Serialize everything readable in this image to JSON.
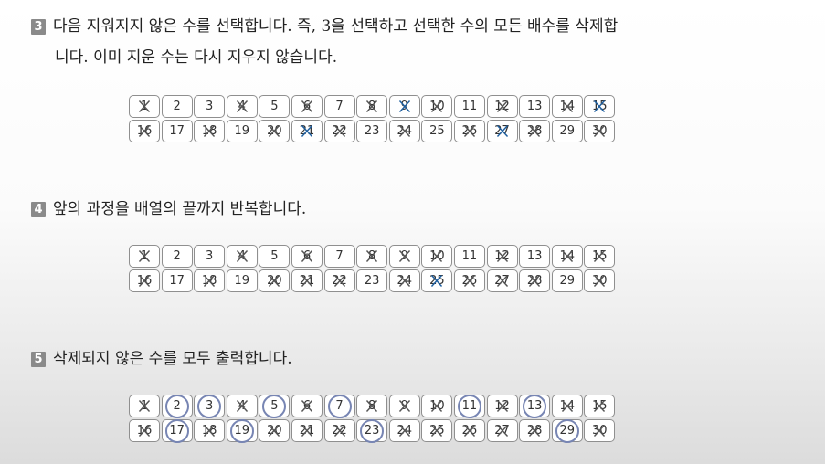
{
  "step3": {
    "badge": "3",
    "line1": "다음 지워지지 않은 수를 선택합니다. 즉, 3을 선택하고 선택한 수의 모든 배수를 삭제합",
    "line2": "니다. 이미 지운 수는 다시 지우지 않습니다."
  },
  "step4": {
    "badge": "4",
    "line1": "앞의 과정을 배열의 끝까지 반복합니다."
  },
  "step5": {
    "badge": "5",
    "line1": "삭제되지 않은 수를 모두 출력합니다."
  },
  "colors": {
    "cross_gray": "#555555",
    "cross_blue": "#1f5f9f",
    "ring": "#7785b3"
  },
  "grids": [
    {
      "name": "grid-step3",
      "cells": [
        {
          "n": "1",
          "mark": "gray"
        },
        {
          "n": "2",
          "mark": "none"
        },
        {
          "n": "3",
          "mark": "none"
        },
        {
          "n": "4",
          "mark": "gray"
        },
        {
          "n": "5",
          "mark": "none"
        },
        {
          "n": "6",
          "mark": "gray"
        },
        {
          "n": "7",
          "mark": "none"
        },
        {
          "n": "8",
          "mark": "gray"
        },
        {
          "n": "9",
          "mark": "blue"
        },
        {
          "n": "10",
          "mark": "gray"
        },
        {
          "n": "11",
          "mark": "none"
        },
        {
          "n": "12",
          "mark": "gray"
        },
        {
          "n": "13",
          "mark": "none"
        },
        {
          "n": "14",
          "mark": "gray"
        },
        {
          "n": "15",
          "mark": "blue"
        },
        {
          "n": "16",
          "mark": "gray"
        },
        {
          "n": "17",
          "mark": "none"
        },
        {
          "n": "18",
          "mark": "gray"
        },
        {
          "n": "19",
          "mark": "none"
        },
        {
          "n": "20",
          "mark": "gray"
        },
        {
          "n": "21",
          "mark": "blue"
        },
        {
          "n": "22",
          "mark": "gray"
        },
        {
          "n": "23",
          "mark": "none"
        },
        {
          "n": "24",
          "mark": "gray"
        },
        {
          "n": "25",
          "mark": "none"
        },
        {
          "n": "26",
          "mark": "gray"
        },
        {
          "n": "27",
          "mark": "blue"
        },
        {
          "n": "28",
          "mark": "gray"
        },
        {
          "n": "29",
          "mark": "none"
        },
        {
          "n": "30",
          "mark": "gray"
        }
      ]
    },
    {
      "name": "grid-step4",
      "cells": [
        {
          "n": "1",
          "mark": "gray"
        },
        {
          "n": "2",
          "mark": "none"
        },
        {
          "n": "3",
          "mark": "none"
        },
        {
          "n": "4",
          "mark": "gray"
        },
        {
          "n": "5",
          "mark": "none"
        },
        {
          "n": "6",
          "mark": "gray"
        },
        {
          "n": "7",
          "mark": "none"
        },
        {
          "n": "8",
          "mark": "gray"
        },
        {
          "n": "9",
          "mark": "gray"
        },
        {
          "n": "10",
          "mark": "gray"
        },
        {
          "n": "11",
          "mark": "none"
        },
        {
          "n": "12",
          "mark": "gray"
        },
        {
          "n": "13",
          "mark": "none"
        },
        {
          "n": "14",
          "mark": "gray"
        },
        {
          "n": "15",
          "mark": "gray"
        },
        {
          "n": "16",
          "mark": "gray"
        },
        {
          "n": "17",
          "mark": "none"
        },
        {
          "n": "18",
          "mark": "gray"
        },
        {
          "n": "19",
          "mark": "none"
        },
        {
          "n": "20",
          "mark": "gray"
        },
        {
          "n": "21",
          "mark": "gray"
        },
        {
          "n": "22",
          "mark": "gray"
        },
        {
          "n": "23",
          "mark": "none"
        },
        {
          "n": "24",
          "mark": "gray"
        },
        {
          "n": "25",
          "mark": "blue"
        },
        {
          "n": "26",
          "mark": "gray"
        },
        {
          "n": "27",
          "mark": "gray"
        },
        {
          "n": "28",
          "mark": "gray"
        },
        {
          "n": "29",
          "mark": "none"
        },
        {
          "n": "30",
          "mark": "gray"
        }
      ]
    },
    {
      "name": "grid-step5",
      "cells": [
        {
          "n": "1",
          "mark": "gray"
        },
        {
          "n": "2",
          "mark": "ring"
        },
        {
          "n": "3",
          "mark": "ring"
        },
        {
          "n": "4",
          "mark": "gray"
        },
        {
          "n": "5",
          "mark": "ring"
        },
        {
          "n": "6",
          "mark": "gray"
        },
        {
          "n": "7",
          "mark": "ring"
        },
        {
          "n": "8",
          "mark": "gray"
        },
        {
          "n": "9",
          "mark": "gray"
        },
        {
          "n": "10",
          "mark": "gray"
        },
        {
          "n": "11",
          "mark": "ring"
        },
        {
          "n": "12",
          "mark": "gray"
        },
        {
          "n": "13",
          "mark": "ring"
        },
        {
          "n": "14",
          "mark": "gray"
        },
        {
          "n": "15",
          "mark": "gray"
        },
        {
          "n": "16",
          "mark": "gray"
        },
        {
          "n": "17",
          "mark": "ring"
        },
        {
          "n": "18",
          "mark": "gray"
        },
        {
          "n": "19",
          "mark": "ring"
        },
        {
          "n": "20",
          "mark": "gray"
        },
        {
          "n": "21",
          "mark": "gray"
        },
        {
          "n": "22",
          "mark": "gray"
        },
        {
          "n": "23",
          "mark": "ring"
        },
        {
          "n": "24",
          "mark": "gray"
        },
        {
          "n": "25",
          "mark": "gray"
        },
        {
          "n": "26",
          "mark": "gray"
        },
        {
          "n": "27",
          "mark": "gray"
        },
        {
          "n": "28",
          "mark": "gray"
        },
        {
          "n": "29",
          "mark": "ring"
        },
        {
          "n": "30",
          "mark": "gray"
        }
      ]
    }
  ]
}
